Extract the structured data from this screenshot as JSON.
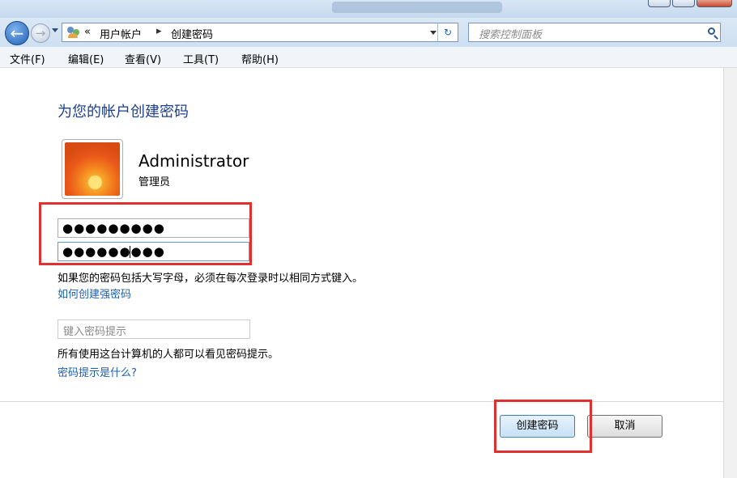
{
  "address_bar": {
    "breadcrumb_chevron": "«",
    "crumbs": [
      "用户帐户",
      "创建密码"
    ],
    "separator": "▸",
    "search_placeholder": "搜索控制面板"
  },
  "menu": [
    "文件(F)",
    "编辑(E)",
    "查看(V)",
    "工具(T)",
    "帮助(H)"
  ],
  "page": {
    "title": "为您的帐户创建密码",
    "user_name": "Administrator",
    "user_role": "管理员",
    "new_password_mask": "●●●●●●●●●",
    "confirm_password_mask": "●●●●●●●●●",
    "caps_note": "如果您的密码包括大写字母，必须在每次登录时以相同方式键入。",
    "strong_password_link": "如何创建强密码",
    "hint_placeholder": "键入密码提示",
    "hint_note": "所有使用这台计算机的人都可以看见密码提示。",
    "hint_link": "密码提示是什么?"
  },
  "buttons": {
    "create": "创建密码",
    "cancel": "取消"
  },
  "colors": {
    "title": "#1e3f8a",
    "link": "#1a5fb4",
    "highlight": "#e0312e"
  },
  "icons": {
    "back": "arrow-left",
    "forward": "arrow-right",
    "refresh": "refresh",
    "search": "magnifier",
    "users": "users"
  }
}
